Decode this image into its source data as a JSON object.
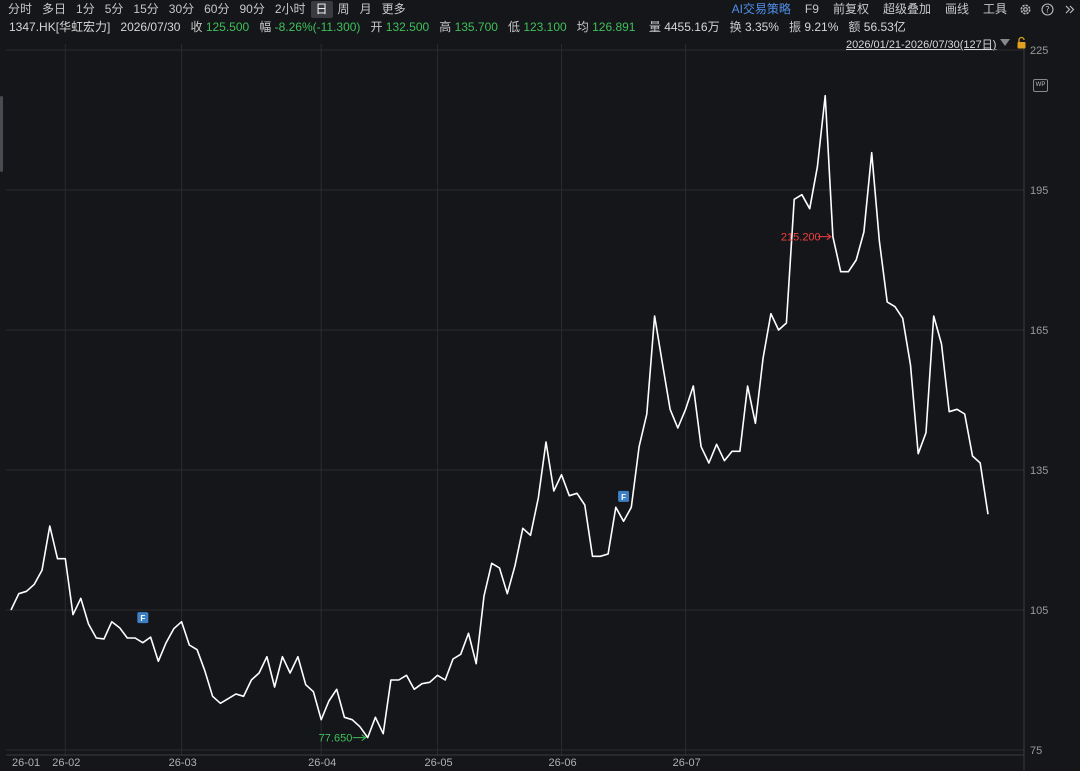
{
  "toolbar": {
    "periods": [
      "分时",
      "多日",
      "1分",
      "5分",
      "15分",
      "30分",
      "60分",
      "90分",
      "2小时",
      "日",
      "周",
      "月",
      "更多"
    ],
    "active_period": "日",
    "right_items": [
      "AI交易策略",
      "F9",
      "前复权",
      "超级叠加",
      "画线",
      "工具"
    ]
  },
  "info": {
    "symbol": "1347.HK[华虹宏力]",
    "date": "2026/07/30",
    "close_label": "收",
    "close": "125.500",
    "change_label": "幅",
    "change": "-8.26%(-11.300)",
    "open_label": "开",
    "open": "132.500",
    "high_label": "高",
    "high": "135.700",
    "low_label": "低",
    "low": "123.100",
    "avg_label": "均",
    "avg": "126.891",
    "volume_label": "量",
    "volume": "4455.16万",
    "turnover_label": "换",
    "turnover": "3.35%",
    "amplitude_label": "振",
    "amplitude": "9.21%",
    "amount_label": "额",
    "amount": "56.53亿"
  },
  "range_label": "2026/01/21-2026/07/30(127日)",
  "wp_label": "WP",
  "colors": {
    "background": "#15161a",
    "line": "#ffffff",
    "grid": "#2a2b30",
    "green": "#3ec05a",
    "red": "#f04040",
    "marker": "#3d7fc4"
  },
  "chart_data": {
    "type": "line",
    "x_tick_labels": [
      "26-01",
      "26-02",
      "26-03",
      "26-04",
      "26-05",
      "26-06",
      "26-07"
    ],
    "x_tick_index": [
      0,
      7,
      22,
      40,
      55,
      71,
      87
    ],
    "y_ticks": [
      75,
      105,
      135,
      165,
      195,
      225
    ],
    "ylim": [
      75,
      225
    ],
    "grid": true,
    "values": [
      105.0,
      108.5,
      109.0,
      110.5,
      113.5,
      123.0,
      116.0,
      116.0,
      104.0,
      107.5,
      102.0,
      99.0,
      98.8,
      102.5,
      101.2,
      99.0,
      99.0,
      98.0,
      99.2,
      94.0,
      98.0,
      101.0,
      102.5,
      97.5,
      96.5,
      92.0,
      86.5,
      85.0,
      86.0,
      87.0,
      86.5,
      90.0,
      91.5,
      95.0,
      88.5,
      95.0,
      91.5,
      95.0,
      89.0,
      87.5,
      81.5,
      85.5,
      88.0,
      82.0,
      81.5,
      80.0,
      77.65,
      82.0,
      78.5,
      90.0,
      90.0,
      91.0,
      88.0,
      89.2,
      89.5,
      91.0,
      90.0,
      94.5,
      95.5,
      100.0,
      93.5,
      108.0,
      115.0,
      114.0,
      108.5,
      114.5,
      122.5,
      121.0,
      129.0,
      141.0,
      130.5,
      134.0,
      129.5,
      130.0,
      127.5,
      116.5,
      116.5,
      117.0,
      127.0,
      124.0,
      127.0,
      140.0,
      147.0,
      168.0,
      158.0,
      148.0,
      144.0,
      148.0,
      153.0,
      140.0,
      136.5,
      140.5,
      137.0,
      139.0,
      139.0,
      153.0,
      145.0,
      159.0,
      168.5,
      165.0,
      166.5,
      193.0,
      194.0,
      191.0,
      200.0,
      215.2,
      185.0,
      177.5,
      177.5,
      180.0,
      186.0,
      203.0,
      184.0,
      171.0,
      170.0,
      167.5,
      157.5,
      138.5,
      143.0,
      168.0,
      162.0,
      147.5,
      148.0,
      147.0,
      138.0,
      136.5,
      125.5
    ],
    "high_annotation": {
      "index": 106,
      "label": "215.200"
    },
    "low_annotation": {
      "index": 46,
      "label": "77.650"
    },
    "markers": [
      {
        "index": 17,
        "label": "F"
      },
      {
        "index": 79,
        "label": "F"
      }
    ]
  }
}
